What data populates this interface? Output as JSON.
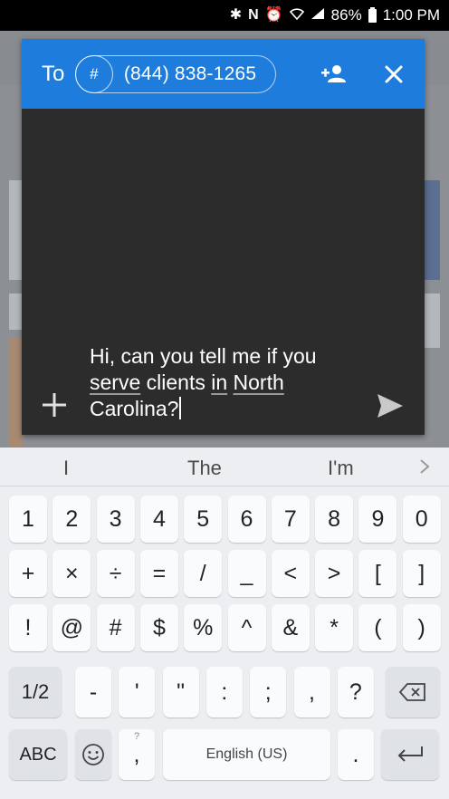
{
  "status_bar": {
    "battery": "86%",
    "time": "1:00 PM",
    "icons": [
      "bluetooth-icon",
      "nfc-icon",
      "alarm-icon",
      "wifi-icon",
      "signal-icon",
      "battery-icon"
    ]
  },
  "dialog": {
    "to_label": "To",
    "recipient_symbol": "#",
    "recipient_number": "(844) 838-1265",
    "header_color": "#1e7cdc",
    "message": {
      "part1": "Hi, can you tell me if you",
      "w_serve": "serve",
      "part2": " clients ",
      "w_in": "in",
      "part3": " ",
      "w_north": "North",
      "part4": "Carolina?"
    }
  },
  "keyboard": {
    "suggestions": [
      "I",
      "The",
      "I'm"
    ],
    "row1": [
      "1",
      "2",
      "3",
      "4",
      "5",
      "6",
      "7",
      "8",
      "9",
      "0"
    ],
    "row2": [
      "+",
      "×",
      "÷",
      "=",
      "/",
      "_",
      "<",
      ">",
      "[",
      "]"
    ],
    "row3": [
      "!",
      "@",
      "#",
      "$",
      "%",
      "^",
      "&",
      "*",
      "(",
      ")"
    ],
    "row4": [
      "1/2",
      "-",
      "'",
      "\"",
      ":",
      ";",
      ",",
      "?"
    ],
    "space_label": "English (US)",
    "abc_label": "ABC",
    "comma_label": ",",
    "comma_sub": "?",
    "period_label": "."
  }
}
